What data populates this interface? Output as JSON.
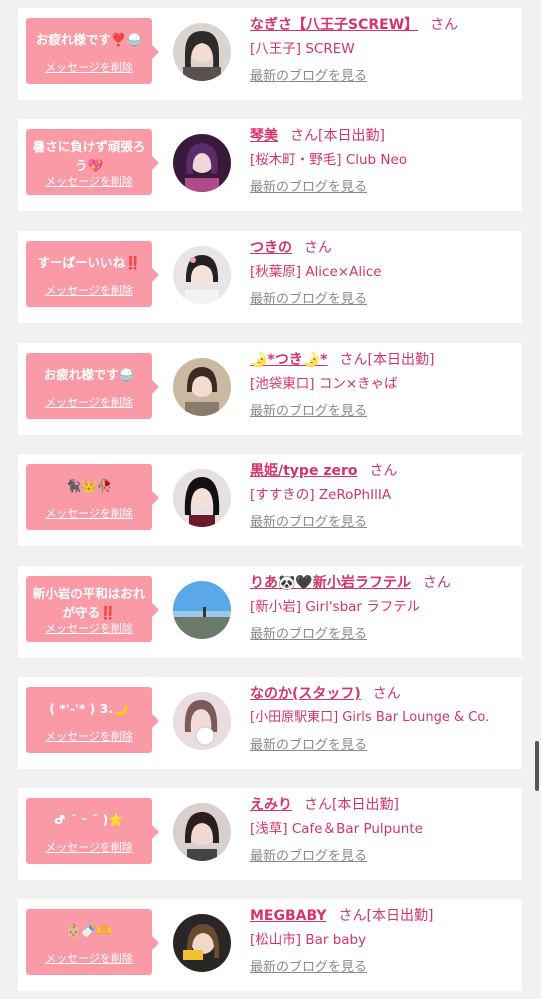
{
  "items": [
    {
      "message": "お疲れ様です❣️🍚",
      "delete_label": "メッセージを削除",
      "name": "なぎさ【八王子SCREW】",
      "honorific": "さん",
      "status": "",
      "shop": "[八王子] SCREW",
      "blog_label": "最新のブログを見る"
    },
    {
      "message": "暑さに負けず頑張ろう💖",
      "delete_label": "メッセージを削除",
      "name": "琴美",
      "honorific": "さん",
      "status": "[本日出勤]",
      "shop": "[桜木町・野毛] Club Neo",
      "blog_label": "最新のブログを見る"
    },
    {
      "message": "すーぱーいいね‼️",
      "delete_label": "メッセージを削除",
      "name": "つきの",
      "honorific": "さん",
      "status": "",
      "shop": "[秋葉原] Alice×Alice",
      "blog_label": "最新のブログを見る"
    },
    {
      "message": "お疲れ様です🍚",
      "delete_label": "メッセージを削除",
      "name": "🌛*つき🌛*",
      "honorific": "さん",
      "status": "[本日出勤]",
      "shop": "[池袋東口] コン×きゃば",
      "blog_label": "最新のブログを見る"
    },
    {
      "message": "🐈‍⬛👑🥀",
      "delete_label": "メッセージを削除",
      "name": "黒姫/type zero",
      "honorific": "さん",
      "status": "",
      "shop": "[すすきの] ZeRoPhIlIA",
      "blog_label": "最新のブログを見る"
    },
    {
      "message": "新小岩の平和はおれが守る‼️",
      "delete_label": "メッセージを削除",
      "name": "りあ🐼🖤新小岩ラフテル",
      "honorific": "さん",
      "status": "",
      "shop": "[新小岩] Girl'sbar ラフテル",
      "blog_label": "最新のブログを見る"
    },
    {
      "message": "( *'-'* ) 3.🌙",
      "delete_label": "メッセージを削除",
      "name": "なのか(スタッフ)",
      "honorific": "さん",
      "status": "",
      "shop": "[小田原駅東口] Girls Bar Lounge & Co.",
      "blog_label": "最新のブログを見る"
    },
    {
      "message": "ᕷ ˘ ᵕ ˘ )⭐",
      "delete_label": "メッセージを削除",
      "name": "えみり",
      "honorific": "さん",
      "status": "[本日出勤]",
      "shop": "[浅草] Cafe＆Bar Pulpunte",
      "blog_label": "最新のブログを見る"
    },
    {
      "message": "👶🏼🍼🫶",
      "delete_label": "メッセージを削除",
      "name": "MEGBABY",
      "honorific": "さん",
      "status": "[本日出勤]",
      "shop": "[松山市] Bar baby",
      "blog_label": "最新のブログを見る"
    }
  ],
  "colors": {
    "accent": "#d6336c",
    "bubble": "#fa9aa6",
    "muted": "#8a8a8a"
  }
}
